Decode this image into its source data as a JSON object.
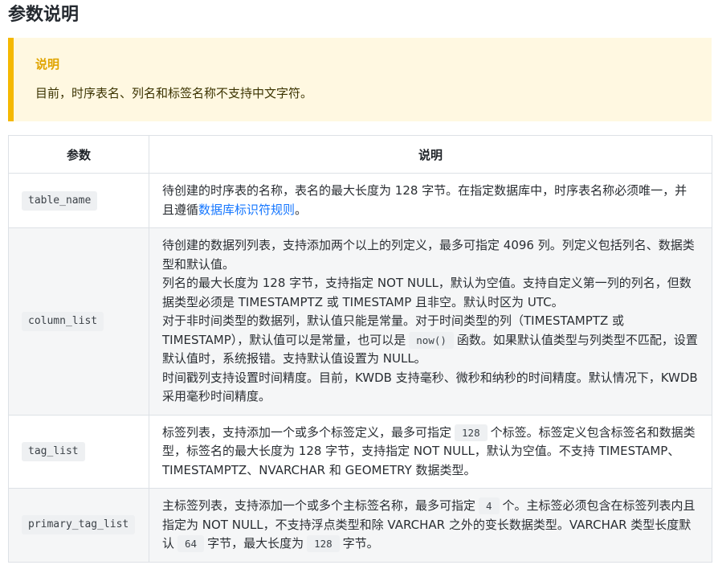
{
  "page": {
    "section_title": "参数说明"
  },
  "callout": {
    "title": "说明",
    "body": "目前，时序表名、列名和标签名称不支持中文字符。",
    "accent_color": "#f5b800",
    "background_color": "#fff8e1"
  },
  "table": {
    "headers": [
      "参数",
      "说明"
    ],
    "rows": [
      {
        "param": "table_name",
        "desc": {
          "text_before_link": "待创建的时序表的名称，表名的最大长度为 128 字节。在指定数据库中，时序表名称必须唯一，并且遵循",
          "link": "数据库标识符规则",
          "text_after_link": "。"
        }
      },
      {
        "param": "column_list",
        "desc": {
          "line1": "待创建的数据列列表，支持添加两个以上的列定义，最多可指定 4096 列。列定义包括列名、数据类型和默认值。",
          "line2": "列名的最大长度为 128 字节，支持指定 NOT NULL，默认为空值。支持自定义第一列的列名，但数据类型必须是 TIMESTAMPTZ 或 TIMESTAMP 且非空。默认时区为 UTC。",
          "line3_before_code": "对于非时间类型的数据列，默认值只能是常量。对于时间类型的列（TIMESTAMPTZ 或 TIMESTAMP），默认值可以是常量，也可以是",
          "line3_code": "now()",
          "line3_after_code": "函数。如果默认值类型与列类型不匹配，设置默认值时，系统报错。支持默认值设置为 NULL。",
          "line4": "时间戳列支持设置时间精度。目前，KWDB 支持毫秒、微秒和纳秒的时间精度。默认情况下，KWDB 采用毫秒时间精度。"
        }
      },
      {
        "param": "tag_list",
        "desc": {
          "before_code": "标签列表，支持添加一个或多个标签定义，最多可指定",
          "code": "128",
          "after_code": "个标签。标签定义包含标签名和数据类型，标签名的最大长度为 128 字节，支持指定 NOT NULL，默认为空值。不支持 TIMESTAMP、TIMESTAMPTZ、NVARCHAR 和 GEOMETRY 数据类型。"
        }
      },
      {
        "param": "primary_tag_list",
        "desc": {
          "before_code1": "主标签列表，支持添加一个或多个主标签名称，最多可指定",
          "code1": "4",
          "between": "个。主标签必须包含在标签列表内且指定为 NOT NULL，不支持浮点类型和除 VARCHAR 之外的变长数据类型。VARCHAR 类型长度默认",
          "code2": "64",
          "between2": "字节，最大长度为",
          "code3": "128",
          "after": "字节。"
        }
      }
    ]
  }
}
